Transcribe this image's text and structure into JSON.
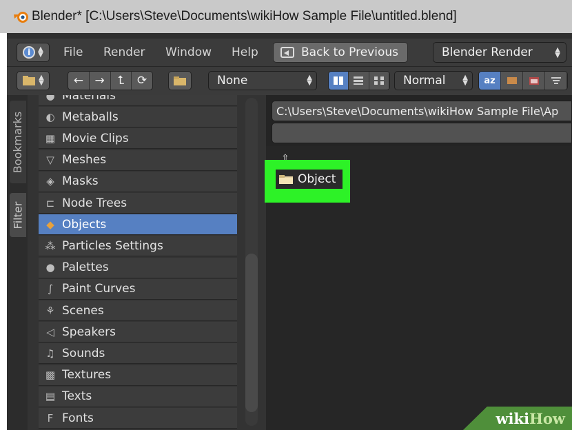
{
  "window": {
    "title": "Blender* [C:\\Users\\Steve\\Documents\\wikiHow Sample File\\untitled.blend]"
  },
  "menubar": {
    "items": [
      "File",
      "Render",
      "Window",
      "Help"
    ],
    "back_button": "Back to Previous",
    "render_engine": "Blender Render"
  },
  "toolbar": {
    "nav_icons": [
      "←",
      "→",
      "⮤",
      "⟳"
    ],
    "recursion": "None",
    "display_size": "Normal",
    "sort_label": "az"
  },
  "sidetabs": [
    "Bookmarks",
    "Filter"
  ],
  "datablock_list": {
    "items": [
      {
        "label": "Materials",
        "icon": "material-sphere-icon",
        "glyph": "●"
      },
      {
        "label": "Metaballs",
        "icon": "metaball-icon",
        "glyph": "◐"
      },
      {
        "label": "Movie Clips",
        "icon": "movie-clip-icon",
        "glyph": "▦"
      },
      {
        "label": "Meshes",
        "icon": "mesh-icon",
        "glyph": "▽"
      },
      {
        "label": "Masks",
        "icon": "mask-icon",
        "glyph": "◈"
      },
      {
        "label": "Node Trees",
        "icon": "node-tree-icon",
        "glyph": "⊏"
      },
      {
        "label": "Objects",
        "icon": "object-cube-icon",
        "glyph": "◆",
        "selected": true
      },
      {
        "label": "Particles Settings",
        "icon": "particles-icon",
        "glyph": "⁂"
      },
      {
        "label": "Palettes",
        "icon": "palette-icon",
        "glyph": "●"
      },
      {
        "label": "Paint Curves",
        "icon": "paint-curve-icon",
        "glyph": "∫"
      },
      {
        "label": "Scenes",
        "icon": "scene-icon",
        "glyph": "⚘"
      },
      {
        "label": "Speakers",
        "icon": "speaker-icon",
        "glyph": "◁"
      },
      {
        "label": "Sounds",
        "icon": "sound-icon",
        "glyph": "♫"
      },
      {
        "label": "Textures",
        "icon": "texture-icon",
        "glyph": "▩"
      },
      {
        "label": "Texts",
        "icon": "text-icon",
        "glyph": "▤"
      },
      {
        "label": "Fonts",
        "icon": "font-icon",
        "glyph": "F"
      }
    ]
  },
  "file_browser": {
    "path": "C:\\Users\\Steve\\Documents\\wikiHow Sample File\\Ap",
    "filename": "",
    "entries": [
      {
        "label": "Object",
        "type": "folder"
      }
    ]
  },
  "watermark": {
    "part1": "wiki",
    "part2": "How"
  },
  "colors": {
    "selection": "#5680c2",
    "highlight": "#2df227",
    "background": "#242424"
  }
}
